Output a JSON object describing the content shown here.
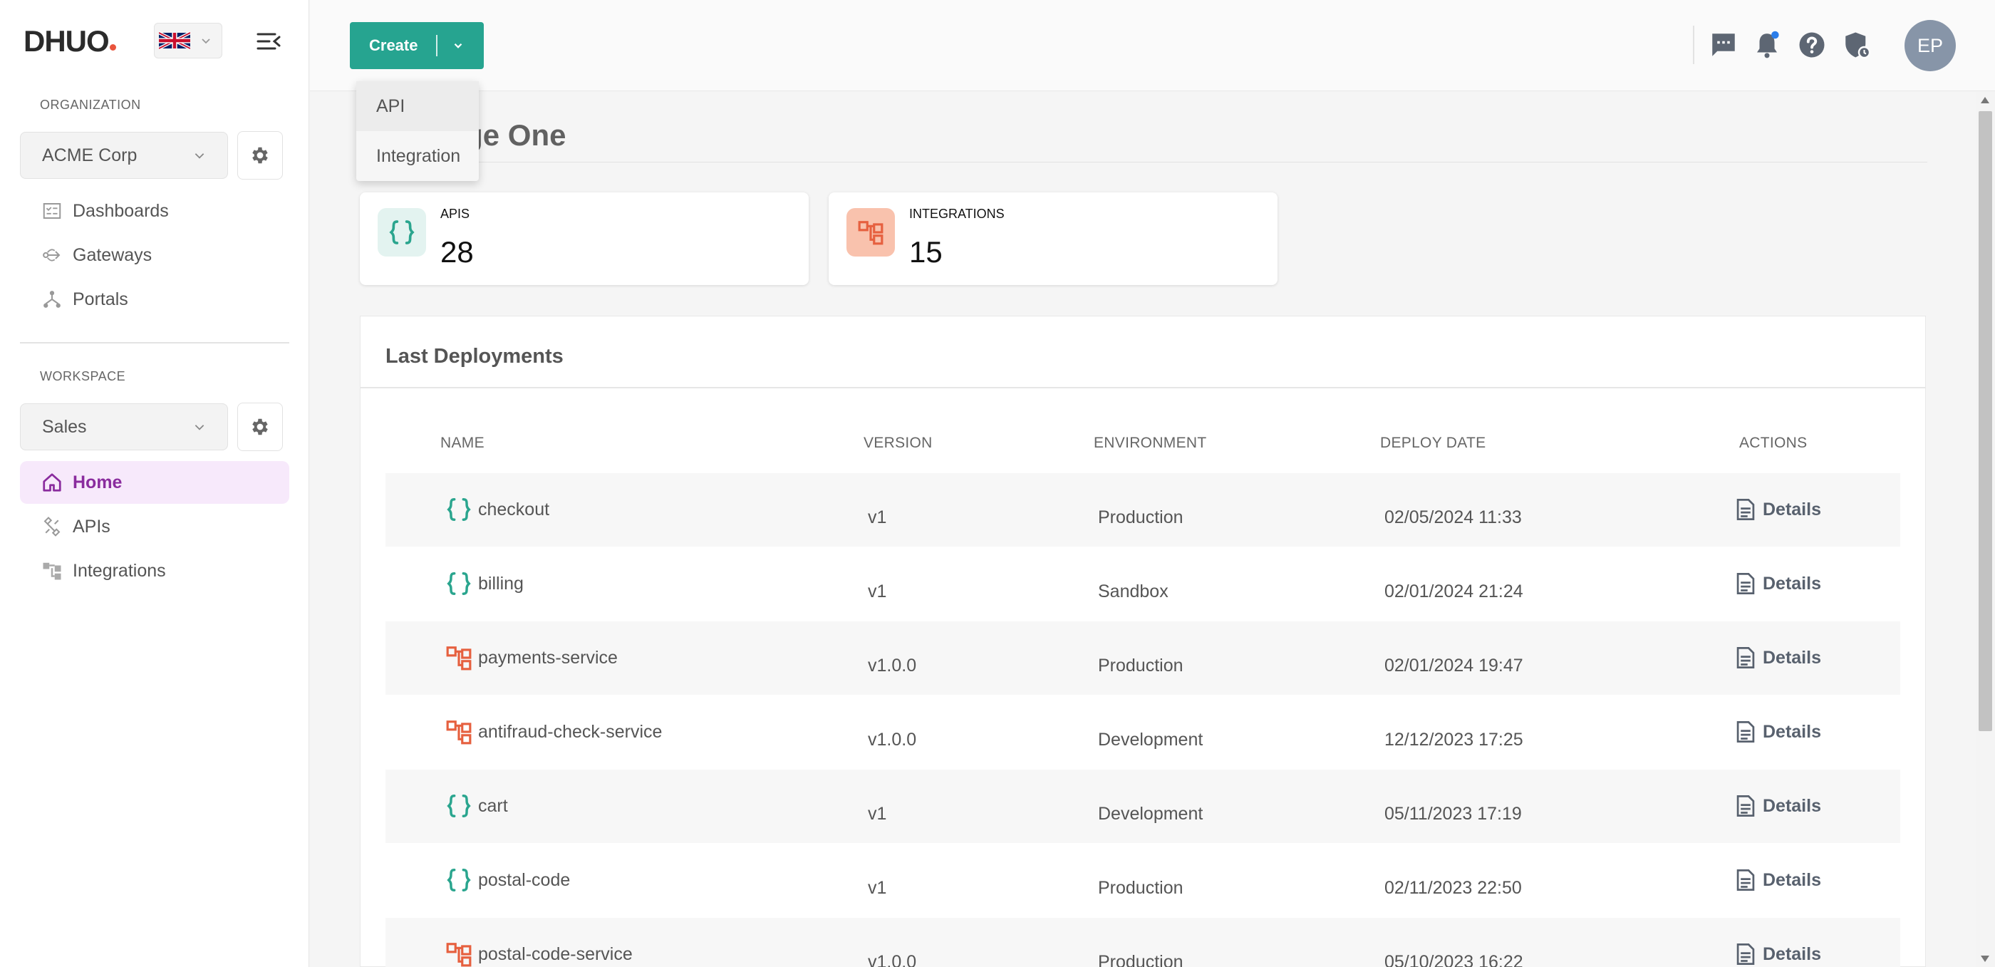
{
  "brand": {
    "name": "DHUO"
  },
  "language": {
    "selected": "English (UK)",
    "flag_icon": "uk-flag-icon"
  },
  "sidebar": {
    "organization_label": "ORGANIZATION",
    "organization_select": "ACME Corp",
    "org_items": [
      {
        "label": "Dashboards",
        "icon": "dashboard-icon"
      },
      {
        "label": "Gateways",
        "icon": "gateway-icon"
      },
      {
        "label": "Portals",
        "icon": "portal-icon"
      }
    ],
    "workspace_label": "WORKSPACE",
    "workspace_select": "Sales",
    "ws_items": [
      {
        "label": "Home",
        "icon": "home-icon",
        "active": true
      },
      {
        "label": "APIs",
        "icon": "apis-icon"
      },
      {
        "label": "Integrations",
        "icon": "integrations-icon"
      }
    ]
  },
  "header": {
    "create_label": "Create",
    "create_menu": [
      "API",
      "Integration"
    ],
    "avatar_initials": "EP",
    "icons": [
      "chat-icon",
      "bell-icon",
      "help-icon",
      "shield-icon"
    ]
  },
  "main": {
    "title": "ace Stage One",
    "stats": [
      {
        "label": "APIS",
        "value": "28",
        "color": "#2aa58e",
        "bg": "#e3f3f0"
      },
      {
        "label": "INTEGRATIONS",
        "value": "15",
        "color": "#e6603f",
        "bg": "#f9c2ad"
      }
    ],
    "deployments": {
      "title": "Last Deployments",
      "columns": [
        "NAME",
        "VERSION",
        "ENVIRONMENT",
        "DEPLOY DATE",
        "ACTIONS"
      ],
      "action_label": "Details",
      "rows": [
        {
          "type": "api",
          "name": "checkout",
          "version": "v1",
          "environment": "Production",
          "date": "02/05/2024 11:33"
        },
        {
          "type": "api",
          "name": "billing",
          "version": "v1",
          "environment": "Sandbox",
          "date": "02/01/2024 21:24"
        },
        {
          "type": "integration",
          "name": "payments-service",
          "version": "v1.0.0",
          "environment": "Production",
          "date": "02/01/2024 19:47"
        },
        {
          "type": "integration",
          "name": "antifraud-check-service",
          "version": "v1.0.0",
          "environment": "Development",
          "date": "12/12/2023 17:25"
        },
        {
          "type": "api",
          "name": "cart",
          "version": "v1",
          "environment": "Development",
          "date": "05/11/2023 17:19"
        },
        {
          "type": "api",
          "name": "postal-code",
          "version": "v1",
          "environment": "Production",
          "date": "02/11/2023 22:50"
        },
        {
          "type": "integration",
          "name": "postal-code-service",
          "version": "v1.0.0",
          "environment": "Production",
          "date": "05/10/2023 16:22"
        }
      ]
    }
  }
}
